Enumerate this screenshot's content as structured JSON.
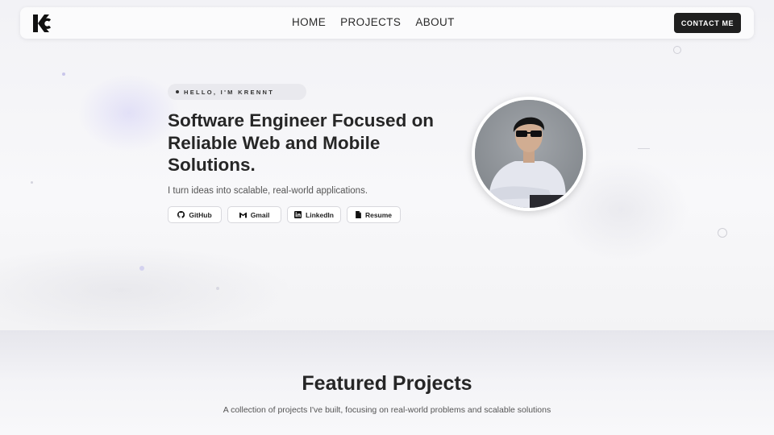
{
  "nav": {
    "links": [
      "HOME",
      "PROJECTS",
      "ABOUT"
    ],
    "contact_label": "CONTACT ME"
  },
  "hero": {
    "badge": "HELLO, I'M KRENNT",
    "headline": "Software Engineer Focused on Reliable Web and Mobile Solutions.",
    "tagline": "I turn ideas into scalable, real-world applications.",
    "links": [
      {
        "label": "GitHub",
        "icon": "github-icon"
      },
      {
        "label": "Gmail",
        "icon": "gmail-icon"
      },
      {
        "label": "LinkedIn",
        "icon": "linkedin-icon"
      },
      {
        "label": "Resume",
        "icon": "document-icon"
      }
    ]
  },
  "projects": {
    "title": "Featured Projects",
    "subtitle": "A collection of projects I've built, focusing on real-world problems and scalable solutions"
  },
  "colors": {
    "accent": "#1f1f1f",
    "background": "#f7f7f9"
  }
}
